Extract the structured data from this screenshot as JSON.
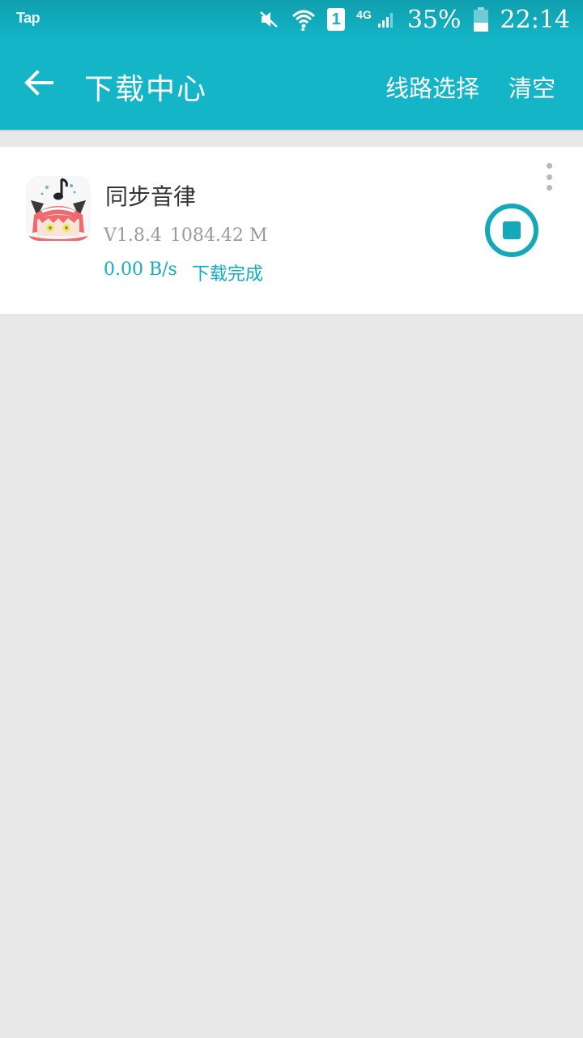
{
  "status_bar": {
    "app_tag": "Tap",
    "network_type": "4G",
    "sim_slot": "1",
    "battery": "35%",
    "time": "22:14",
    "icons": [
      "mute-icon",
      "wifi-icon",
      "sim-icon",
      "signal-icon",
      "battery-icon"
    ]
  },
  "app_bar": {
    "back_icon": "arrow-left-icon",
    "title": "下载中心",
    "actions": {
      "route_select": "线路选择",
      "clear": "清空"
    }
  },
  "downloads": [
    {
      "name": "同步音律",
      "version": "V1.8.4",
      "size": "1084.42 M",
      "speed": "0.00 B/s",
      "status": "下载完成",
      "action_icon": "stop-icon",
      "menu_icon": "more-vertical-icon"
    }
  ],
  "colors": {
    "primary": "#13b5c7",
    "accent": "#15a8b9",
    "background": "#e8e8e8"
  }
}
